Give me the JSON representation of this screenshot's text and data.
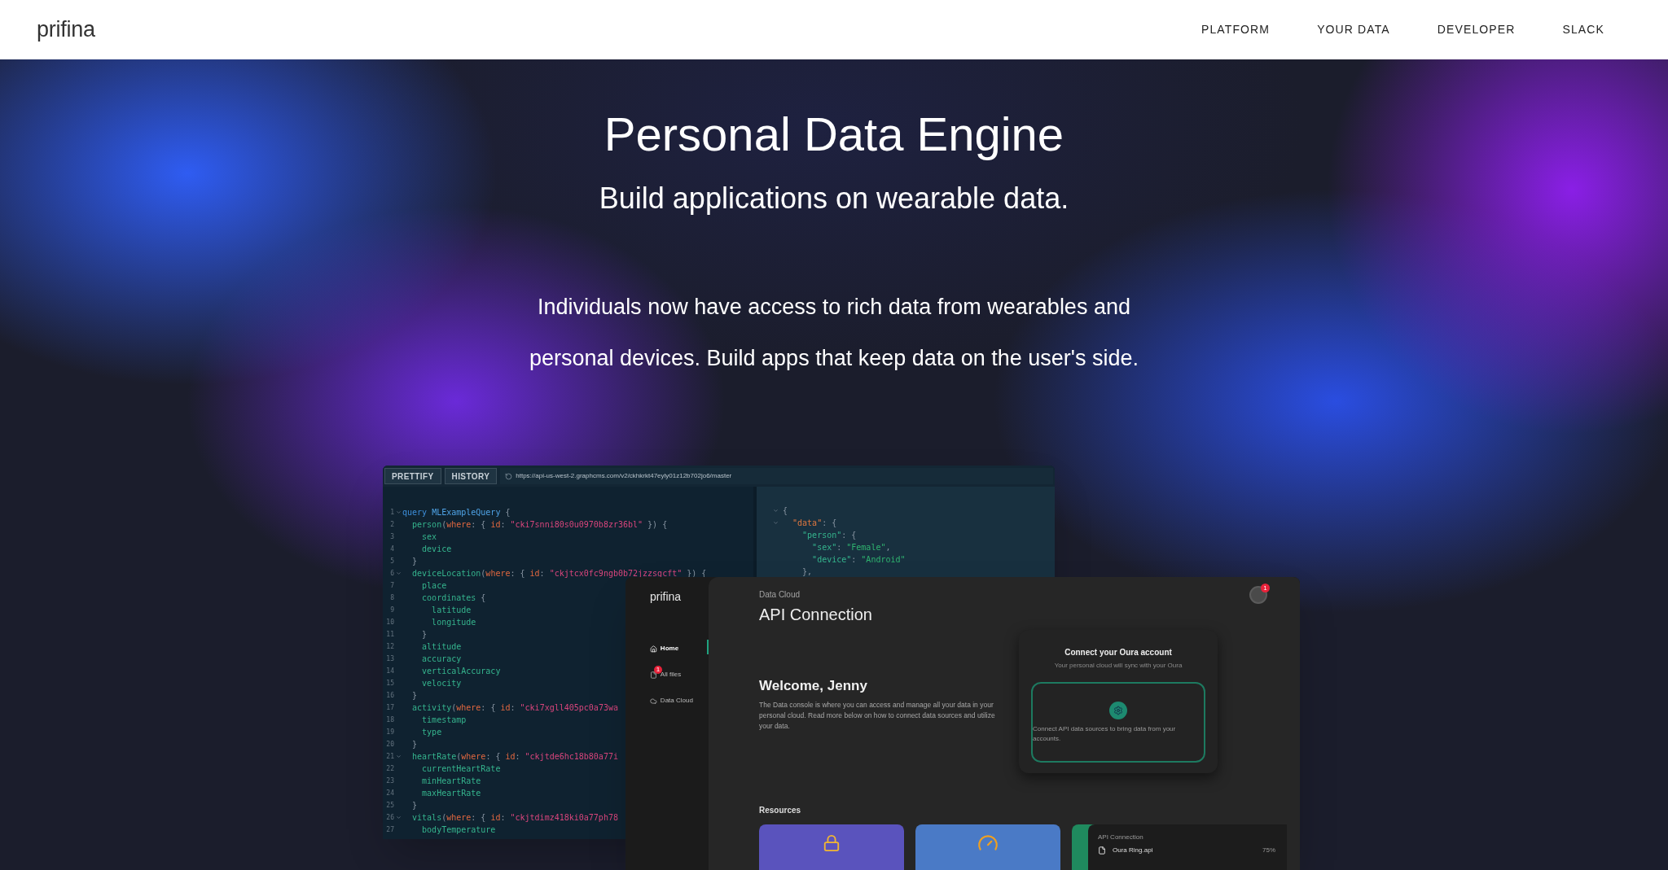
{
  "header": {
    "logo": "prifina",
    "nav": [
      {
        "label": "PLATFORM"
      },
      {
        "label": "YOUR DATA"
      },
      {
        "label": "DEVELOPER"
      },
      {
        "label": "SLACK"
      }
    ]
  },
  "hero": {
    "title": "Personal Data Engine",
    "subtitle": "Build applications on wearable data.",
    "paragraph": "Individuals now have access to rich data from wearables and personal devices. Build apps that keep data on the user's side."
  },
  "editor": {
    "buttons": [
      "PRETTIFY",
      "HISTORY"
    ],
    "url": "https://api-us-west-2.graphcms.com/v2/ckhkrkt47eyly01z12b702jo6/master",
    "lines": [
      {
        "n": "1",
        "fold": true,
        "parts": [
          {
            "kind": "keyword",
            "t": "query "
          },
          {
            "kind": "name",
            "t": "MLExampleQuery"
          },
          {
            "kind": "punct",
            "t": " {"
          }
        ]
      },
      {
        "n": "2",
        "fold": false,
        "parts": [
          {
            "kind": "field",
            "t": "  person"
          },
          {
            "kind": "punct",
            "t": "("
          },
          {
            "kind": "arg",
            "t": "where"
          },
          {
            "kind": "punct",
            "t": ": { "
          },
          {
            "kind": "arg",
            "t": "id"
          },
          {
            "kind": "punct",
            "t": ": "
          },
          {
            "kind": "string",
            "t": "\"cki7snni80s0u0970b8zr36bl\""
          },
          {
            "kind": "punct",
            "t": " }) {"
          }
        ]
      },
      {
        "n": "3",
        "fold": false,
        "parts": [
          {
            "kind": "field",
            "t": "    sex"
          }
        ]
      },
      {
        "n": "4",
        "fold": false,
        "parts": [
          {
            "kind": "field",
            "t": "    device"
          }
        ]
      },
      {
        "n": "5",
        "fold": false,
        "parts": [
          {
            "kind": "punct",
            "t": "  }"
          }
        ]
      },
      {
        "n": "6",
        "fold": true,
        "parts": [
          {
            "kind": "field",
            "t": "  deviceLocation"
          },
          {
            "kind": "punct",
            "t": "("
          },
          {
            "kind": "arg",
            "t": "where"
          },
          {
            "kind": "punct",
            "t": ": { "
          },
          {
            "kind": "arg",
            "t": "id"
          },
          {
            "kind": "punct",
            "t": ": "
          },
          {
            "kind": "string",
            "t": "\"ckjtcx0fc9ngb0b72jzzsgcft\""
          },
          {
            "kind": "punct",
            "t": " }) {"
          }
        ]
      },
      {
        "n": "7",
        "fold": false,
        "parts": [
          {
            "kind": "field",
            "t": "    place"
          }
        ]
      },
      {
        "n": "8",
        "fold": false,
        "parts": [
          {
            "kind": "field",
            "t": "    coordinates"
          },
          {
            "kind": "punct",
            "t": " {"
          }
        ]
      },
      {
        "n": "9",
        "fold": false,
        "parts": [
          {
            "kind": "field",
            "t": "      latitude"
          }
        ]
      },
      {
        "n": "10",
        "fold": false,
        "parts": [
          {
            "kind": "field",
            "t": "      longitude"
          }
        ]
      },
      {
        "n": "11",
        "fold": false,
        "parts": [
          {
            "kind": "punct",
            "t": "    }"
          }
        ]
      },
      {
        "n": "12",
        "fold": false,
        "parts": [
          {
            "kind": "field",
            "t": "    altitude"
          }
        ]
      },
      {
        "n": "13",
        "fold": false,
        "parts": [
          {
            "kind": "field",
            "t": "    accuracy"
          }
        ]
      },
      {
        "n": "14",
        "fold": false,
        "parts": [
          {
            "kind": "field",
            "t": "    verticalAccuracy"
          }
        ]
      },
      {
        "n": "15",
        "fold": false,
        "parts": [
          {
            "kind": "field",
            "t": "    velocity"
          }
        ]
      },
      {
        "n": "16",
        "fold": false,
        "parts": [
          {
            "kind": "punct",
            "t": "  }"
          }
        ]
      },
      {
        "n": "17",
        "fold": false,
        "parts": [
          {
            "kind": "field",
            "t": "  activity"
          },
          {
            "kind": "punct",
            "t": "("
          },
          {
            "kind": "arg",
            "t": "where"
          },
          {
            "kind": "punct",
            "t": ": { "
          },
          {
            "kind": "arg",
            "t": "id"
          },
          {
            "kind": "punct",
            "t": ": "
          },
          {
            "kind": "string",
            "t": "\"cki7xgll405pc0a73wa"
          }
        ]
      },
      {
        "n": "18",
        "fold": false,
        "parts": [
          {
            "kind": "field",
            "t": "    timestamp"
          }
        ]
      },
      {
        "n": "19",
        "fold": false,
        "parts": [
          {
            "kind": "field",
            "t": "    type"
          }
        ]
      },
      {
        "n": "20",
        "fold": false,
        "parts": [
          {
            "kind": "punct",
            "t": "  }"
          }
        ]
      },
      {
        "n": "21",
        "fold": true,
        "parts": [
          {
            "kind": "field",
            "t": "  heartRate"
          },
          {
            "kind": "punct",
            "t": "("
          },
          {
            "kind": "arg",
            "t": "where"
          },
          {
            "kind": "punct",
            "t": ": { "
          },
          {
            "kind": "arg",
            "t": "id"
          },
          {
            "kind": "punct",
            "t": ": "
          },
          {
            "kind": "string",
            "t": "\"ckjtde6hc18b80a77i"
          }
        ]
      },
      {
        "n": "22",
        "fold": false,
        "parts": [
          {
            "kind": "field",
            "t": "    currentHeartRate"
          }
        ]
      },
      {
        "n": "23",
        "fold": false,
        "parts": [
          {
            "kind": "field",
            "t": "    minHeartRate"
          }
        ]
      },
      {
        "n": "24",
        "fold": false,
        "parts": [
          {
            "kind": "field",
            "t": "    maxHeartRate"
          }
        ]
      },
      {
        "n": "25",
        "fold": false,
        "parts": [
          {
            "kind": "punct",
            "t": "  }"
          }
        ]
      },
      {
        "n": "26",
        "fold": true,
        "parts": [
          {
            "kind": "field",
            "t": "  vitals"
          },
          {
            "kind": "punct",
            "t": "("
          },
          {
            "kind": "arg",
            "t": "where"
          },
          {
            "kind": "punct",
            "t": ": { "
          },
          {
            "kind": "arg",
            "t": "id"
          },
          {
            "kind": "punct",
            "t": ": "
          },
          {
            "kind": "string",
            "t": "\"ckjtdimz418ki0a77ph78"
          }
        ]
      },
      {
        "n": "27",
        "fold": false,
        "parts": [
          {
            "kind": "field",
            "t": "    bodyTemperature"
          }
        ]
      }
    ],
    "result": [
      {
        "fold": true,
        "parts": [
          {
            "kind": "punct",
            "t": "{"
          }
        ]
      },
      {
        "fold": true,
        "parts": [
          {
            "kind": "key",
            "t": "  \"data\""
          },
          {
            "kind": "punct",
            "t": ": {"
          }
        ]
      },
      {
        "fold": false,
        "parts": [
          {
            "kind": "field",
            "t": "    \"person\""
          },
          {
            "kind": "punct",
            "t": ": {"
          }
        ]
      },
      {
        "fold": false,
        "parts": [
          {
            "kind": "field",
            "t": "      \"sex\""
          },
          {
            "kind": "punct",
            "t": ": "
          },
          {
            "kind": "value",
            "t": "\"Female\""
          },
          {
            "kind": "punct",
            "t": ","
          }
        ]
      },
      {
        "fold": false,
        "parts": [
          {
            "kind": "field",
            "t": "      \"device\""
          },
          {
            "kind": "punct",
            "t": ": "
          },
          {
            "kind": "value",
            "t": "\"Android\""
          }
        ]
      },
      {
        "fold": false,
        "parts": [
          {
            "kind": "punct",
            "t": "    },"
          }
        ]
      }
    ]
  },
  "app": {
    "logo": "prifina",
    "nav": [
      {
        "label": "Home",
        "kind": "home",
        "selected": true
      },
      {
        "label": "All files",
        "kind": "file",
        "selected": false,
        "badge": "1"
      },
      {
        "label": "Data Cloud",
        "kind": "cloud",
        "selected": false
      }
    ],
    "breadcrumb": "Data Cloud",
    "title": "API Connection",
    "avatar_badge": "1",
    "welcome": "Welcome, Jenny",
    "intro": "The Data console is where you can access and manage all your data in your personal cloud. Read more below on how to connect data sources and utilize your data.",
    "connect": {
      "title": "Connect your Oura account",
      "subtitle": "Your personal cloud will sync with your Oura",
      "hint": "Connect API data sources to bring data from your accounts."
    },
    "resources_title": "Resources",
    "resources": [
      {
        "kind": "lock",
        "color": "#5a53bd"
      },
      {
        "kind": "gauge",
        "color": "#4a7ac6"
      },
      {
        "kind": "upload",
        "color": "#1f8a5e",
        "panel_title": "API Connection",
        "file": "Oura Ring.api",
        "percent": "75%"
      }
    ]
  }
}
